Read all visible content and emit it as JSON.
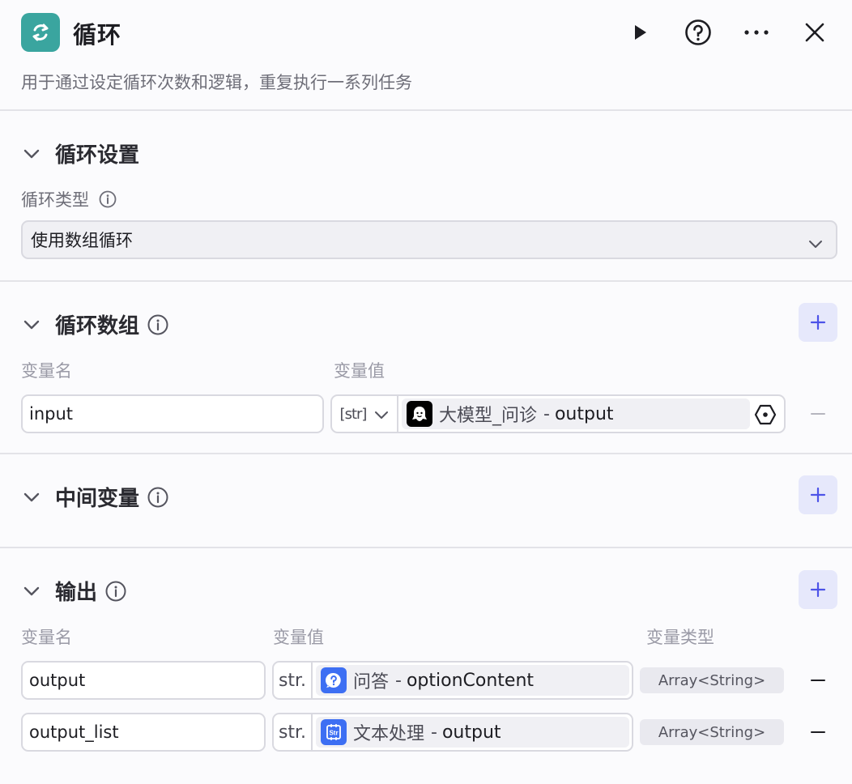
{
  "header": {
    "icon": "loop-icon",
    "title": "循环",
    "description": "用于通过设定循环次数和逻辑，重复执行一系列任务",
    "actions": [
      "play-icon",
      "help-icon",
      "more-icon",
      "close-icon"
    ]
  },
  "loop_settings": {
    "title": "循环设置",
    "type_label": "循环类型",
    "type_value": "使用数组循环"
  },
  "loop_array": {
    "title": "循环数组",
    "col_name": "变量名",
    "col_value": "变量值",
    "rows": [
      {
        "name": "input",
        "type": "[str]",
        "source": "大模型_问诊",
        "field": "output"
      }
    ]
  },
  "intermediate": {
    "title": "中间变量"
  },
  "output": {
    "title": "输出",
    "col_name": "变量名",
    "col_value": "变量值",
    "col_type": "变量类型",
    "rows": [
      {
        "name": "output",
        "type": "str.",
        "source": "问答",
        "field": "optionContent",
        "var_type": "Array<String>",
        "icon": "question-icon"
      },
      {
        "name": "output_list",
        "type": "str.",
        "source": "文本处理",
        "field": "output",
        "var_type": "Array<String>",
        "icon": "text-process-icon"
      }
    ]
  },
  "colors": {
    "accent": "#4d53e8",
    "loop_icon_bg": "#3aa59f",
    "ref_icon_blue": "#3d6ff3"
  }
}
